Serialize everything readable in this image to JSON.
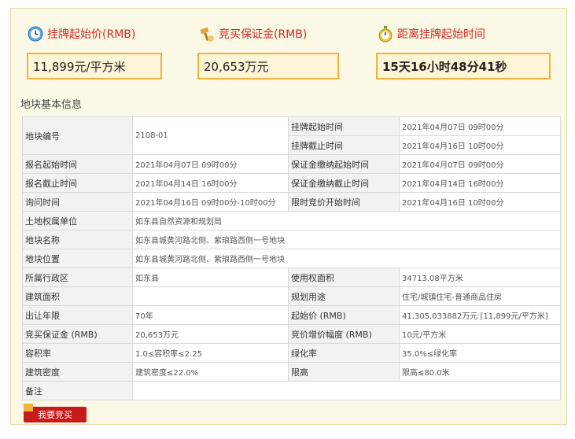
{
  "headers": {
    "start_price_label": "挂牌起始价(RMB)",
    "deposit_label": "竞买保证金(RMB)",
    "countdown_label": "距离挂牌起始时间"
  },
  "values": {
    "start_price": "11,899元/平方米",
    "deposit": "20,653万元",
    "countdown": "15天16小时48分41秒"
  },
  "section_title": "地块基本信息",
  "table": {
    "parcel_no_label": "地块编号",
    "parcel_no": "2108-01",
    "listing_start_label": "挂牌起始时间",
    "listing_start": "2021年04月07日 09时00分",
    "listing_end_label": "挂牌截止时间",
    "listing_end": "2021年04月16日 10时00分",
    "reg_start_label": "报名起始时间",
    "reg_start": "2021年04月07日 09时00分",
    "deposit_start_label": "保证金缴纳起始时间",
    "deposit_start": "2021年04月07日 09时00分",
    "reg_end_label": "报名截止时间",
    "reg_end": "2021年04月14日 16时00分",
    "deposit_end_label": "保证金缴纳截止时间",
    "deposit_end": "2021年04月14日 16时00分",
    "inquiry_label": "询问时间",
    "inquiry": "2021年04月16日 09时00分-10时00分",
    "timed_bid_label": "限时竞价开始时间",
    "timed_bid": "2021年04月16日 10时00分",
    "land_owner_label": "土地权属单位",
    "land_owner": "如东县自然资源和规划局",
    "parcel_name_label": "地块名称",
    "parcel_name": "如东县城黄河路北侧、紫琅路西侧一号地块",
    "parcel_location_label": "地块位置",
    "parcel_location": "如东县城黄河路北侧、紫琅路西侧一号地块",
    "district_label": "所属行政区",
    "district": "如东县",
    "use_area_label": "使用权面积",
    "use_area": "34713.08平方米",
    "build_area_label": "建筑面积",
    "build_area": "",
    "plan_use_label": "规划用途",
    "plan_use": "住宅/城镇住宅-普通商品住房",
    "term_label": "出让年限",
    "term": "70年",
    "start_price2_label": "起始价 (RMB)",
    "start_price2": "41,305.033882万元 [11,899元/平方米]",
    "deposit2_label": "竞买保证金 (RMB)",
    "deposit2": "20,653万元",
    "increment_label": "竞价增价幅度 (RMB)",
    "increment": "10元/平方米",
    "far_label": "容积率",
    "far": "1.0≤容积率≤2.25",
    "green_label": "绿化率",
    "green": "35.0%≤绿化率",
    "density_label": "建筑密度",
    "density": "建筑密度≤22.0%",
    "height_label": "限高",
    "height": "限高≤80.0米",
    "remark_label": "备注",
    "remark": ""
  },
  "bid_button": "我要竞买",
  "colors": {
    "accent": "#d62a1e",
    "box_border": "#f2b13d",
    "button": "#c8191b"
  },
  "icons": [
    "clock-icon",
    "gavel-icon",
    "stopwatch-icon"
  ]
}
